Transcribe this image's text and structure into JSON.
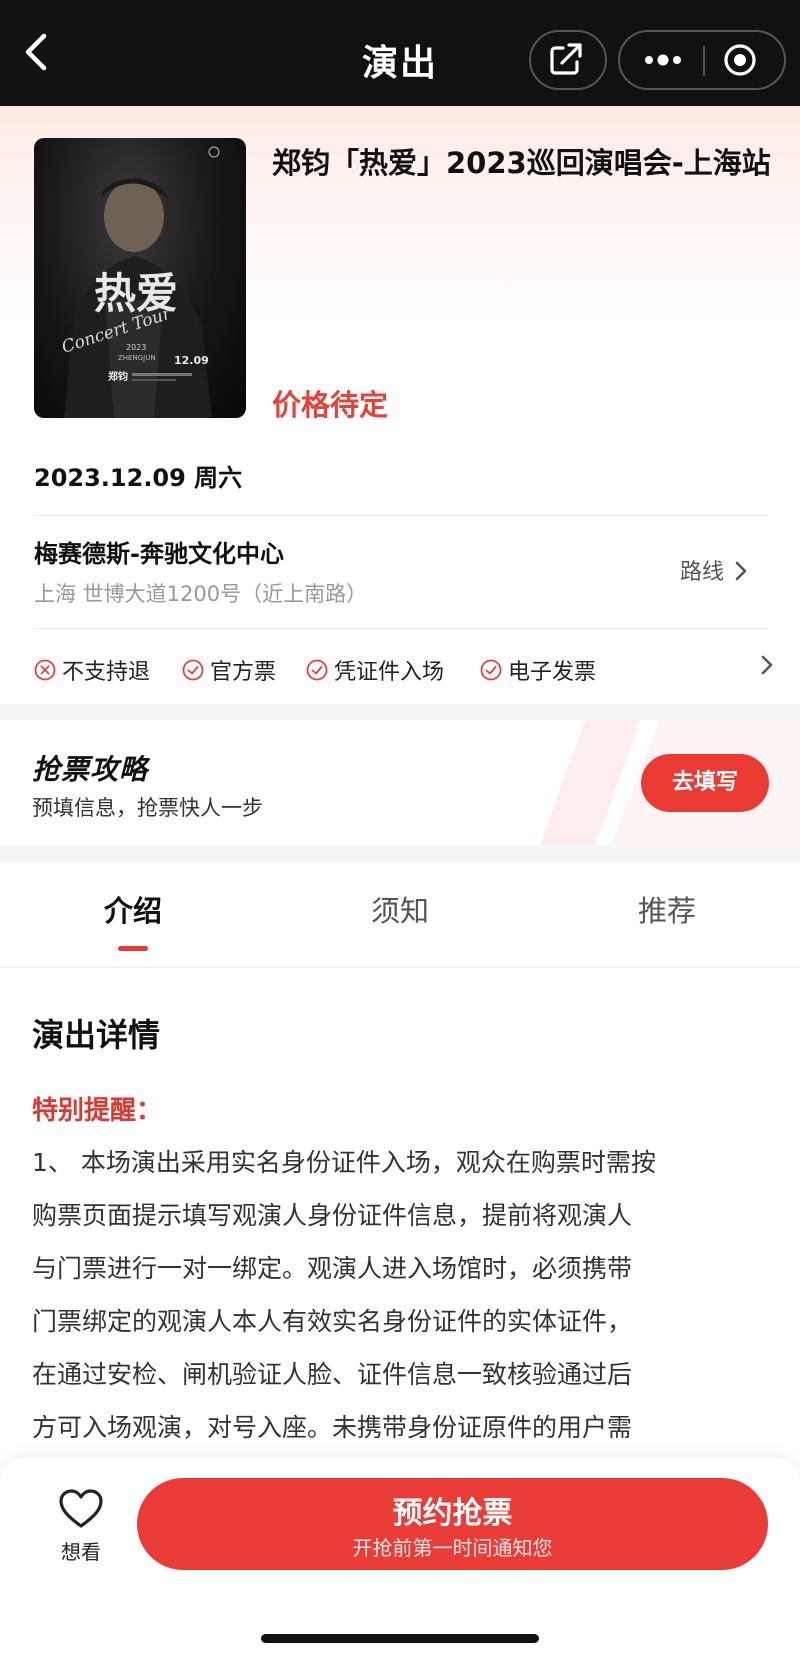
{
  "topbar": {
    "title": "演出",
    "icons": [
      "back-icon",
      "share-icon",
      "more-icon",
      "close-circle-icon"
    ]
  },
  "event": {
    "title": "郑钧「热爱」2023巡回演唱会-上海站",
    "price": "价格待定",
    "date": "2023.12.09 周六",
    "venue": {
      "name": "梅赛德斯-奔驰文化中心",
      "address": "上海 世博大道1200号（近上南路）",
      "route_label": "路线"
    },
    "tags": [
      {
        "label": "不支持退",
        "icon": "x-circle-icon",
        "color": "#e8413a"
      },
      {
        "label": "官方票",
        "icon": "check-circle-icon",
        "color": "#e8413a"
      },
      {
        "label": "凭证件入场",
        "icon": "check-circle-icon",
        "color": "#e8413a"
      },
      {
        "label": "电子发票",
        "icon": "check-circle-icon",
        "color": "#e8413a"
      }
    ],
    "poster": {
      "title_art": "热爱",
      "script_art": "Concert Tour",
      "year": "2023",
      "name_en": "ZHENGJUN",
      "date_mark": "12.09",
      "name_cn": "郑钧"
    }
  },
  "strategy": {
    "title": "抢票攻略",
    "subtitle": "预填信息，抢票快人一步",
    "button": "去填写"
  },
  "tabs": {
    "items": [
      "介绍",
      "须知",
      "推荐"
    ],
    "active": 0
  },
  "details": {
    "section_title": "演出详情",
    "reminder_label": "特别提醒：",
    "lines": [
      "1、 本场演出采用实名身份证件入场，观众在购票时需按",
      "购票页面提示填写观演人身份证件信息，提前将观演人",
      "与门票进行一对一绑定。观演人进入场馆时，必须携带",
      "门票绑定的观演人本人有效实名身份证件的实体证件，",
      "在通过安检、闸机验证人脸、证件信息一致核验通过后",
      "方可入场观演，对号入座。未携带身份证原件的用户需"
    ]
  },
  "bottom": {
    "fav_label": "想看",
    "cta_main": "预约抢票",
    "cta_sub": "开抢前第一时间通知您"
  },
  "colors": {
    "accent": "#e93a34",
    "topbar": "#111111"
  }
}
